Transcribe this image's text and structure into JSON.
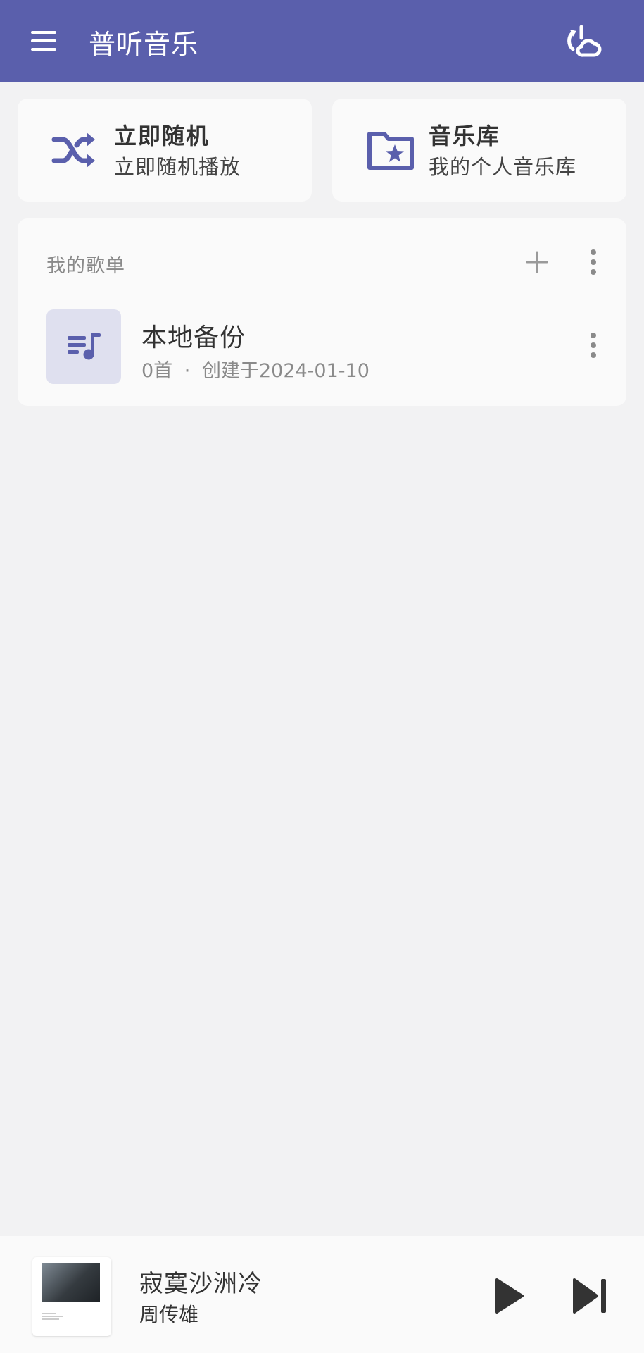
{
  "app": {
    "title": "普听音乐"
  },
  "quick_actions": [
    {
      "title": "立即随机",
      "subtitle": "立即随机播放",
      "icon": "shuffle-icon"
    },
    {
      "title": "音乐库",
      "subtitle": "我的个人音乐库",
      "icon": "folder-star-icon"
    }
  ],
  "playlists": {
    "header": "我的歌单",
    "items": [
      {
        "name": "本地备份",
        "count": "0首",
        "separator": "·",
        "created": "创建于2024-01-10"
      }
    ]
  },
  "now_playing": {
    "title": "寂寞沙洲冷",
    "artist": "周传雄"
  },
  "colors": {
    "primary": "#5a5fac",
    "background": "#f2f2f3",
    "card": "#fafafa",
    "icon_tint": "#5a5fac",
    "cover_tint": "#dfe0ef"
  }
}
